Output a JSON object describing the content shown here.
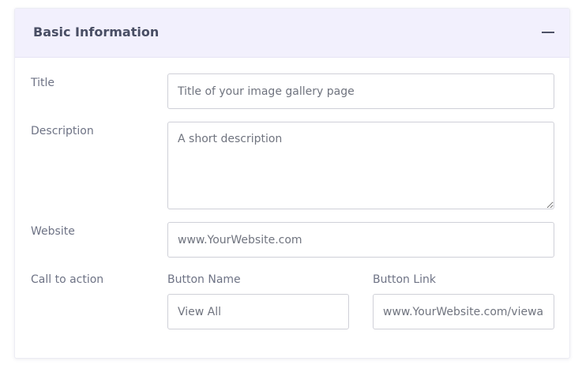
{
  "card": {
    "title": "Basic Information",
    "collapse_icon": "minus-icon"
  },
  "form": {
    "title": {
      "label": "Title",
      "placeholder": "Title of your image gallery page",
      "value": ""
    },
    "description": {
      "label": "Description",
      "placeholder": "A short description",
      "value": ""
    },
    "website": {
      "label": "Website",
      "placeholder": "www.YourWebsite.com",
      "value": ""
    },
    "call_to_action": {
      "label": "Call to action",
      "button_name": {
        "label": "Button Name",
        "placeholder": "View All",
        "value": ""
      },
      "button_link": {
        "label": "Button Link",
        "placeholder": "www.YourWebsite.com/viewall",
        "value": ""
      }
    }
  },
  "colors": {
    "header_background": "#f2f0fd",
    "title_text": "#494e64",
    "label_text": "#6e7385",
    "input_border": "#cfd0d8"
  }
}
